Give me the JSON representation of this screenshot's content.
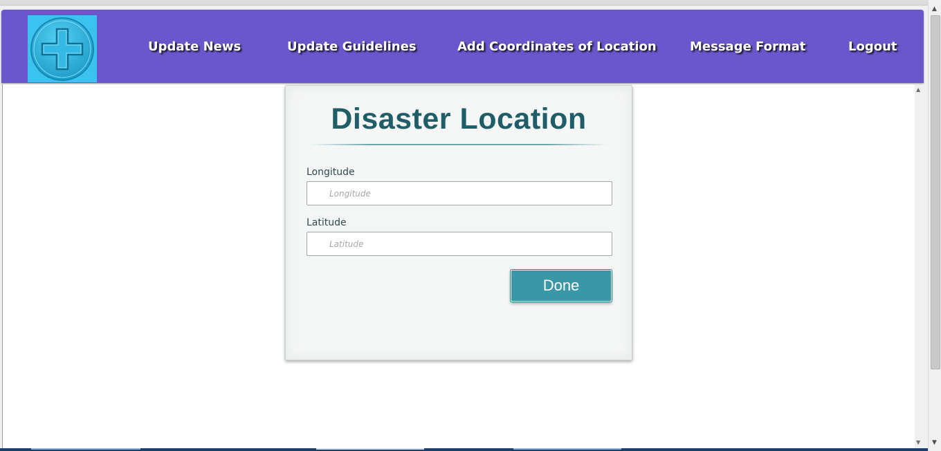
{
  "nav": {
    "logo_icon": "medical-cross-icon",
    "links": [
      {
        "label": "Update News"
      },
      {
        "label": "Update Guidelines"
      },
      {
        "label": "Add Coordinates of Location"
      },
      {
        "label": "Message Format"
      },
      {
        "label": "Logout"
      }
    ]
  },
  "form": {
    "title": "Disaster Location",
    "longitude": {
      "label": "Longitude",
      "placeholder": "Longitude",
      "value": ""
    },
    "latitude": {
      "label": "Latitude",
      "placeholder": "Latitude",
      "value": ""
    },
    "submit_label": "Done"
  },
  "colors": {
    "navbar": "#6b57cc",
    "logo_bg": "#3cc2ee",
    "title": "#1f5e69",
    "button": "#3a97a7"
  }
}
